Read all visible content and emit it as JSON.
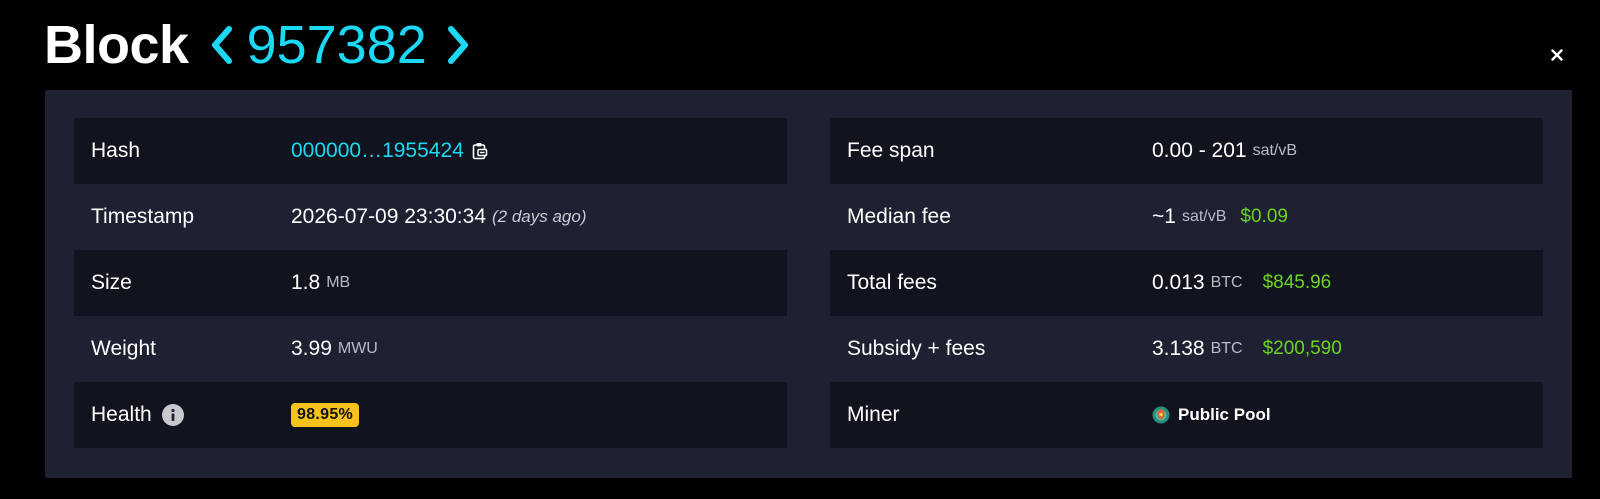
{
  "header": {
    "title": "Block",
    "height": "957382",
    "prev_icon": "chevron-left-icon",
    "next_icon": "chevron-right-icon",
    "close_glyph": "×",
    "accent_color": "#1bd8f4"
  },
  "left": {
    "hash": {
      "label": "Hash",
      "value": "000000…1955424",
      "copy_icon": "clipboard-icon"
    },
    "timestamp": {
      "label": "Timestamp",
      "value": "2026-07-09 23:30:34",
      "relative": "(2 days ago)"
    },
    "size": {
      "label": "Size",
      "value": "1.8",
      "unit": "MB"
    },
    "weight": {
      "label": "Weight",
      "value": "3.99",
      "unit": "MWU"
    },
    "health": {
      "label": "Health",
      "value": "98.95%",
      "info_icon": "info-icon",
      "badge_color": "#f7c31a"
    }
  },
  "right": {
    "fee_span": {
      "label": "Fee span",
      "value": "0.00 - 201",
      "unit": "sat/vB"
    },
    "median_fee": {
      "label": "Median fee",
      "value": "~1",
      "unit": "sat/vB",
      "fiat": "$0.09"
    },
    "total_fees": {
      "label": "Total fees",
      "value": "0.013",
      "unit": "BTC",
      "fiat": "$845.96"
    },
    "subsidy_fees": {
      "label": "Subsidy + fees",
      "value": "3.138",
      "unit": "BTC",
      "fiat": "$200,590"
    },
    "miner": {
      "label": "Miner",
      "value": "Public Pool",
      "logo_icon": "pool-logo-icon"
    }
  },
  "colors": {
    "background": "#000000",
    "panel": "#1d2131",
    "row_alt": "#11141e",
    "fiat_green": "#6cd41f"
  }
}
